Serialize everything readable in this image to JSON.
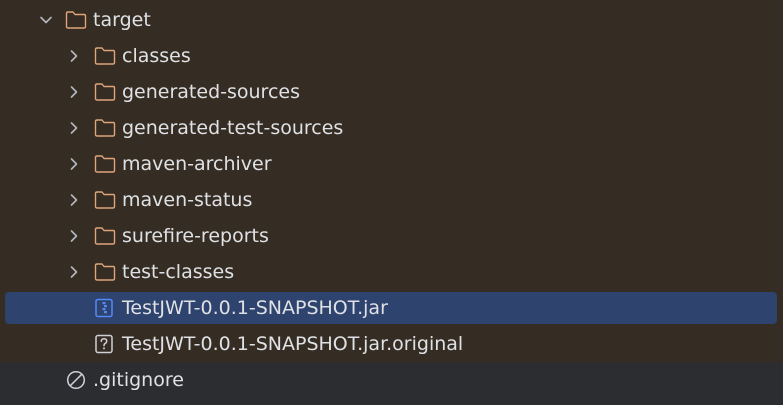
{
  "project_tree": {
    "target": {
      "label": "target",
      "expanded": true
    },
    "children": [
      {
        "label": "classes",
        "type": "folder"
      },
      {
        "label": "generated-sources",
        "type": "folder"
      },
      {
        "label": "generated-test-sources",
        "type": "folder"
      },
      {
        "label": "maven-archiver",
        "type": "folder"
      },
      {
        "label": "maven-status",
        "type": "folder"
      },
      {
        "label": "surefire-reports",
        "type": "folder"
      },
      {
        "label": "test-classes",
        "type": "folder"
      }
    ],
    "files": [
      {
        "label": "TestJWT-0.0.1-SNAPSHOT.jar",
        "icon": "archive-icon",
        "selected": true
      },
      {
        "label": "TestJWT-0.0.1-SNAPSHOT.jar.original",
        "icon": "unknown-file-icon",
        "selected": false
      }
    ],
    "ignored": {
      "label": ".gitignore",
      "icon": "ignored-file-icon"
    }
  },
  "colors": {
    "panel_background": "#2b2d30",
    "target_highlight": "#352d23",
    "selection": "#2e436e",
    "folder_icon": "#e0a37a",
    "chevron": "#b4b8bf",
    "text": "#dfe1e5",
    "archive_icon": "#548af7"
  }
}
